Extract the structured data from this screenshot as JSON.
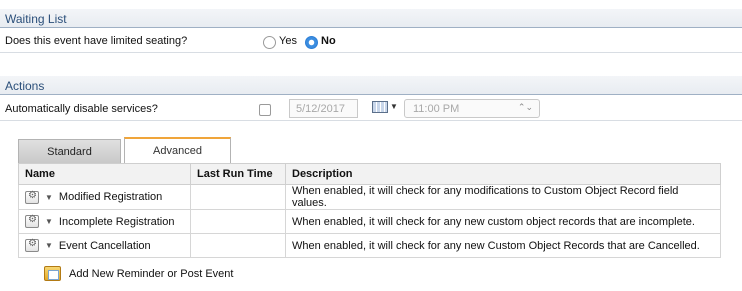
{
  "waiting_list": {
    "title": "Waiting List",
    "question": "Does this event have limited seating?",
    "options": [
      {
        "label": "Yes",
        "selected": false
      },
      {
        "label": "No",
        "selected": true
      }
    ]
  },
  "actions": {
    "title": "Actions",
    "question": "Automatically disable services?",
    "checked": false,
    "date_value": "5/12/2017",
    "time_value": "11:00 PM",
    "calendar_icon": "calendar-icon"
  },
  "tabs": [
    {
      "label": "Standard",
      "active": false
    },
    {
      "label": "Advanced",
      "active": true
    }
  ],
  "table": {
    "headers": [
      "Name",
      "Last Run Time",
      "Description"
    ],
    "rows": [
      {
        "name": "Modified Registration",
        "last_run": "",
        "description": "When enabled, it will check for any modifications to Custom Object Record field values."
      },
      {
        "name": "Incomplete Registration",
        "last_run": "",
        "description": "When enabled, it will check for any new custom object records that are incomplete."
      },
      {
        "name": "Event Cancellation",
        "last_run": "",
        "description": "When enabled, it will check for any new Custom Object Records that are Cancelled."
      }
    ]
  },
  "add_link": {
    "label": "Add New Reminder or Post Event",
    "icon": "add-event-icon"
  },
  "colors": {
    "section_title": "#2b4f7a",
    "tab_accent": "#f0a53a",
    "radio_selected": "#3b8de0"
  }
}
